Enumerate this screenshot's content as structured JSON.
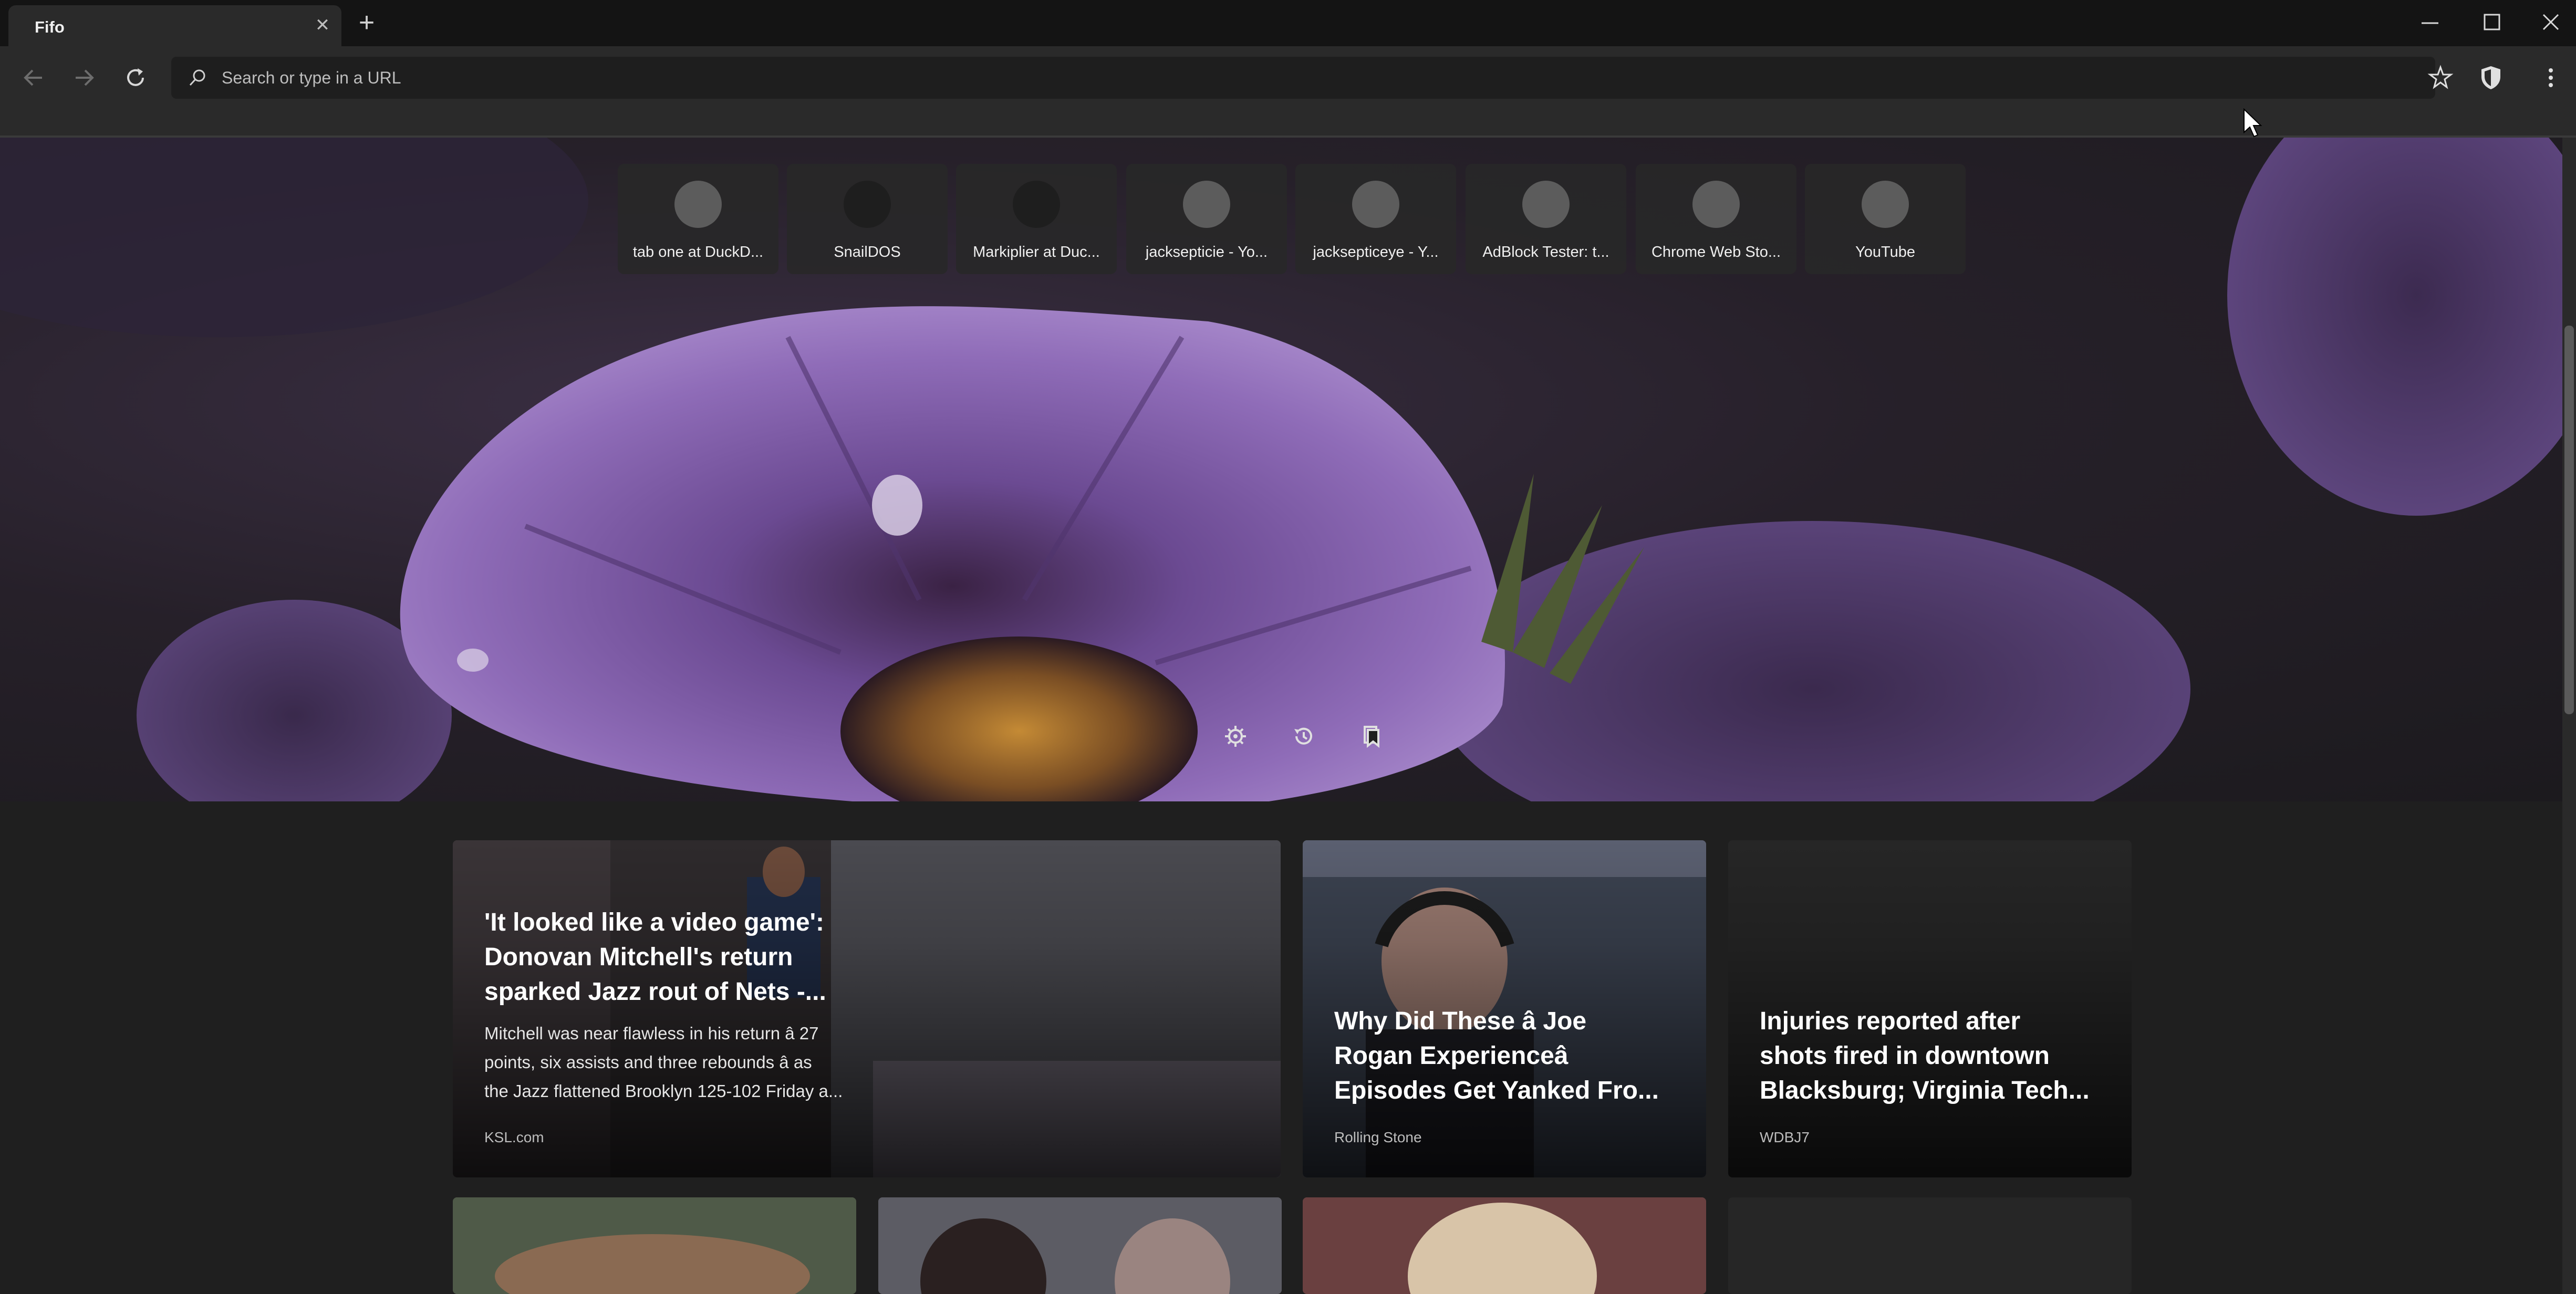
{
  "tab": {
    "title": "Fifo"
  },
  "omnibox": {
    "placeholder": "Search or type in a URL"
  },
  "top_sites": [
    {
      "label": "tab one at DuckD..."
    },
    {
      "label": "SnailDOS"
    },
    {
      "label": "Markiplier at Duc..."
    },
    {
      "label": "jacksepticie - Yo..."
    },
    {
      "label": "jacksepticeye - Y..."
    },
    {
      "label": "AdBlock Tester: t..."
    },
    {
      "label": "Chrome Web Sto..."
    },
    {
      "label": "YouTube"
    }
  ],
  "news": [
    {
      "title_lines": [
        "'It looked like a video game':",
        "Donovan Mitchell's return",
        "sparked Jazz rout of Nets -..."
      ],
      "desc_lines": [
        "Mitchell was near flawless in his return â   27",
        "points, six assists and three rebounds â   as",
        "the Jazz flattened Brooklyn 125-102 Friday a..."
      ],
      "source": "KSL.com"
    },
    {
      "title_lines": [
        "Why Did These â  Joe",
        "Rogan Experienceâ",
        "Episodes Get Yanked Fro..."
      ],
      "source": "Rolling Stone"
    },
    {
      "title_lines": [
        "Injuries reported after",
        "shots fired in downtown",
        "Blacksburg; Virginia Tech..."
      ],
      "source": "WDBJ7"
    }
  ],
  "colors": {
    "accent_purple": "#8f6cb8",
    "background": "#1f1f1f",
    "toolbar": "#2a2a2a"
  }
}
